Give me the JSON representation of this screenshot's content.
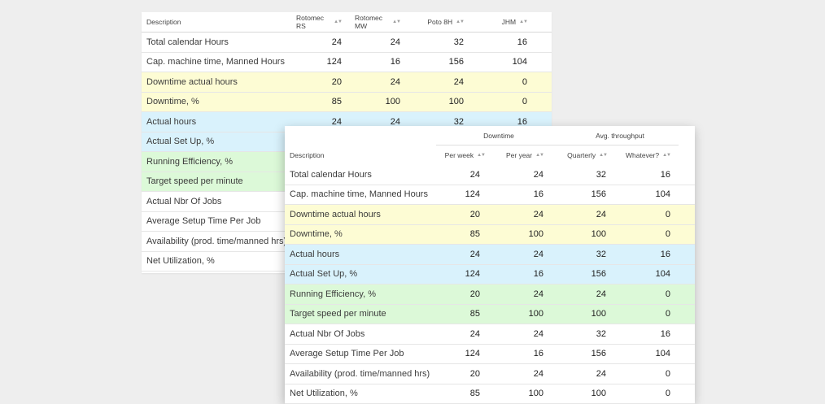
{
  "back_table": {
    "headers": [
      "Description",
      "Rotomec RS",
      "Rotomec MW",
      "Poto 8H",
      "JHM"
    ],
    "rows": [
      {
        "desc": "Total calendar Hours",
        "v": [
          "24",
          "24",
          "32",
          "16"
        ],
        "tone": "white"
      },
      {
        "desc": "Cap. machine time, Manned Hours",
        "v": [
          "124",
          "16",
          "156",
          "104"
        ],
        "tone": "white"
      },
      {
        "desc": "Downtime actual hours",
        "v": [
          "20",
          "24",
          "24",
          "0"
        ],
        "tone": "yellow"
      },
      {
        "desc": "Downtime, %",
        "v": [
          "85",
          "100",
          "100",
          "0"
        ],
        "tone": "yellow"
      },
      {
        "desc": "Actual hours",
        "v": [
          "24",
          "24",
          "32",
          "16"
        ],
        "tone": "blue"
      },
      {
        "desc": "Actual Set Up, %",
        "v": [
          "",
          "",
          "",
          ""
        ],
        "tone": "blue"
      },
      {
        "desc": "Running Efficiency, %",
        "v": [
          "",
          "",
          "",
          ""
        ],
        "tone": "green"
      },
      {
        "desc": "Target speed per minute",
        "v": [
          "",
          "",
          "",
          ""
        ],
        "tone": "green"
      },
      {
        "desc": "Actual Nbr Of Jobs",
        "v": [
          "",
          "",
          "",
          ""
        ],
        "tone": "white"
      },
      {
        "desc": "Average Setup Time Per Job",
        "v": [
          "",
          "",
          "",
          ""
        ],
        "tone": "white"
      },
      {
        "desc": "Availability (prod. time/manned hrs)",
        "v": [
          "",
          "",
          "",
          ""
        ],
        "tone": "white"
      },
      {
        "desc": "Net Utilization, %",
        "v": [
          "",
          "",
          "",
          ""
        ],
        "tone": "white"
      }
    ]
  },
  "front_table": {
    "groups": [
      "Downtime",
      "Avg. throughput"
    ],
    "headers": [
      "Description",
      "Per week",
      "Per year",
      "Quarterly",
      "Whatever?"
    ],
    "rows": [
      {
        "desc": "Total calendar Hours",
        "v": [
          "24",
          "24",
          "32",
          "16"
        ],
        "tone": "white"
      },
      {
        "desc": "Cap. machine time, Manned Hours",
        "v": [
          "124",
          "16",
          "156",
          "104"
        ],
        "tone": "white"
      },
      {
        "desc": "Downtime actual hours",
        "v": [
          "20",
          "24",
          "24",
          "0"
        ],
        "tone": "yellow"
      },
      {
        "desc": "Downtime, %",
        "v": [
          "85",
          "100",
          "100",
          "0"
        ],
        "tone": "yellow"
      },
      {
        "desc": "Actual hours",
        "v": [
          "24",
          "24",
          "32",
          "16"
        ],
        "tone": "blue"
      },
      {
        "desc": "Actual Set Up, %",
        "v": [
          "124",
          "16",
          "156",
          "104"
        ],
        "tone": "blue"
      },
      {
        "desc": "Running Efficiency, %",
        "v": [
          "20",
          "24",
          "24",
          "0"
        ],
        "tone": "green"
      },
      {
        "desc": "Target speed per minute",
        "v": [
          "85",
          "100",
          "100",
          "0"
        ],
        "tone": "green"
      },
      {
        "desc": "Actual Nbr Of Jobs",
        "v": [
          "24",
          "24",
          "32",
          "16"
        ],
        "tone": "white"
      },
      {
        "desc": "Average Setup Time Per Job",
        "v": [
          "124",
          "16",
          "156",
          "104"
        ],
        "tone": "white"
      },
      {
        "desc": "Availability (prod. time/manned hrs)",
        "v": [
          "20",
          "24",
          "24",
          "0"
        ],
        "tone": "white"
      },
      {
        "desc": "Net Utilization, %",
        "v": [
          "85",
          "100",
          "100",
          "0"
        ],
        "tone": "white"
      }
    ]
  },
  "sort_icon": "sort-arrows-icon",
  "colors": {
    "yellow": "#fdfcd4",
    "blue": "#d9f2fc",
    "green": "#dcf9d8"
  }
}
